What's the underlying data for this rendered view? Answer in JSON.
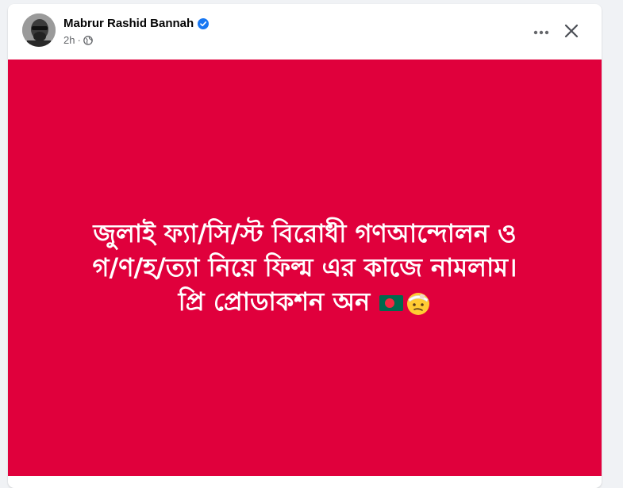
{
  "post": {
    "author": "Mabrur Rashid Bannah",
    "time": "2h",
    "separator": "·",
    "background_color": "#e0003c",
    "text_color": "#ffffff",
    "lines": [
      "জুলাই ফ্যা/সি/স্ট বিরোধী গণআন্দোলন ও",
      "গ/ণ/হ/ত্যা নিয়ে ফিল্ম এর কাজে নামলাম।",
      "প্রি প্রোডাকশন অন"
    ],
    "emojis": [
      "flag-bangladesh-icon",
      "face-with-head-bandage-icon"
    ]
  },
  "colors": {
    "verified": "#1877f2",
    "meta": "#65676b",
    "page_bg": "#f0f2f5"
  }
}
